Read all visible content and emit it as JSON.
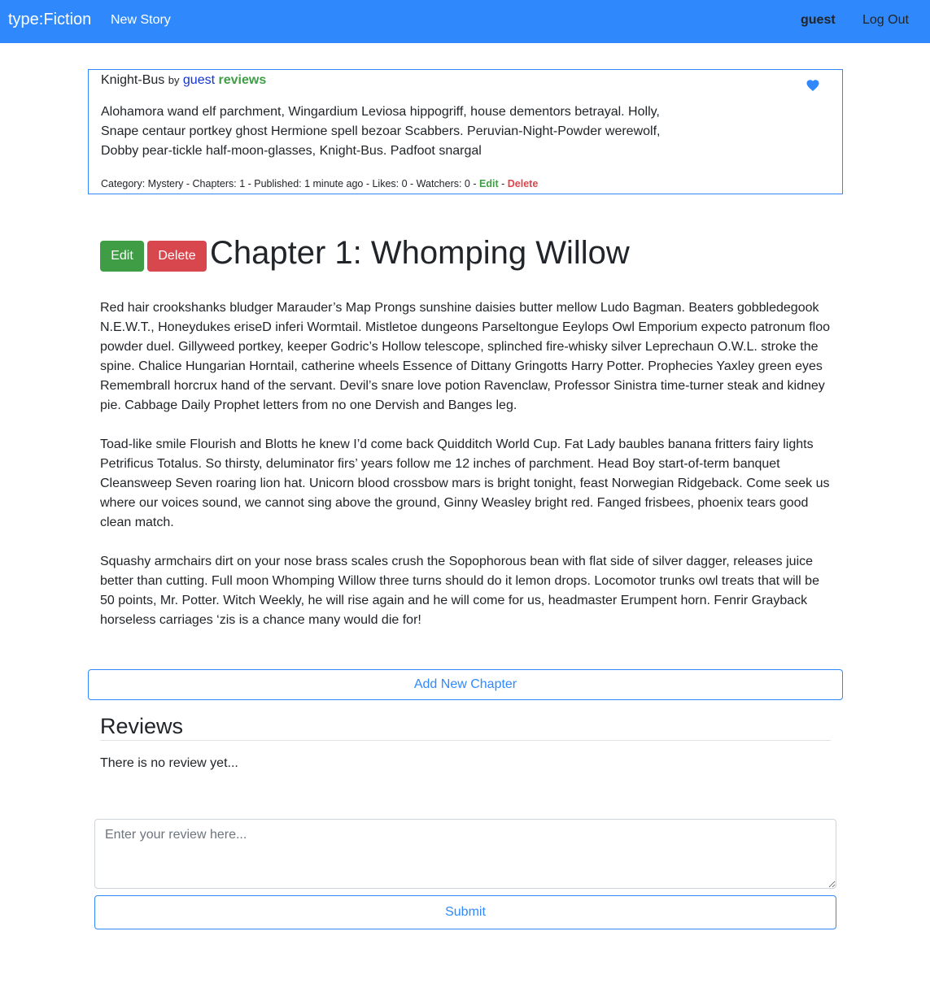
{
  "navbar": {
    "brand": "type:Fiction",
    "new_story": "New Story",
    "username": "guest",
    "logout": "Log Out",
    "color": "#2f89fc"
  },
  "story": {
    "title": "Knight-Bus",
    "by": "by",
    "author": "guest",
    "reviews_link": "reviews",
    "heart_icon": "heart-icon",
    "summary": "Alohamora wand elf parchment, Wingardium Leviosa hippogriff, house dementors betrayal. Holly, Snape centaur portkey ghost Hermione spell bezoar Scabbers. Peruvian-Night-Powder werewolf, Dobby pear-tickle half-moon-glasses, Knight-Bus. Padfoot snargal",
    "meta": "Category: Mystery - Chapters: 1 - Published: 1 minute ago - Likes: 0 - Watchers: 0 -",
    "meta_separator": "-",
    "edit_link": "Edit",
    "delete_link": "Delete"
  },
  "chapter": {
    "edit_button": "Edit",
    "delete_button": "Delete",
    "title": "Chapter 1: Whomping Willow",
    "paragraphs": [
      "Red hair crookshanks bludger Marauder’s Map Prongs sunshine daisies butter mellow Ludo Bagman. Beaters gobbledegook N.E.W.T., Honeydukes eriseD inferi Wormtail. Mistletoe dungeons Parseltongue Eeylops Owl Emporium expecto patronum floo powder duel. Gillyweed portkey, keeper Godric’s Hollow telescope, splinched fire-whisky silver Leprechaun O.W.L. stroke the spine. Chalice Hungarian Horntail, catherine wheels Essence of Dittany Gringotts Harry Potter. Prophecies Yaxley green eyes Remembrall horcrux hand of the servant. Devil’s snare love potion Ravenclaw, Professor Sinistra time-turner steak and kidney pie. Cabbage Daily Prophet letters from no one Dervish and Banges leg.",
      "Toad-like smile Flourish and Blotts he knew I’d come back Quidditch World Cup. Fat Lady baubles banana fritters fairy lights Petrificus Totalus. So thirsty, deluminator firs’ years follow me 12 inches of parchment. Head Boy start-of-term banquet Cleansweep Seven roaring lion hat. Unicorn blood crossbow mars is bright tonight, feast Norwegian Ridgeback. Come seek us where our voices sound, we cannot sing above the ground, Ginny Weasley bright red. Fanged frisbees, phoenix tears good clean match.",
      "Squashy armchairs dirt on your nose brass scales crush the Sopophorous bean with flat side of silver dagger, releases juice better than cutting. Full moon Whomping Willow three turns should do it lemon drops. Locomotor trunks owl treats that will be 50 points, Mr. Potter. Witch Weekly, he will rise again and he will come for us, headmaster Erumpent horn. Fenrir Grayback horseless carriages ‘zis is a chance many would die for!"
    ],
    "add_chapter_button": "Add New Chapter"
  },
  "reviews": {
    "title": "Reviews",
    "empty_text": "There is no review yet...",
    "input_placeholder": "Enter your review here...",
    "input_value": "",
    "submit_button": "Submit"
  },
  "colors": {
    "primary": "#2f89fc",
    "success": "#3f9e45",
    "danger": "#d9474e",
    "author_link": "#1033d8"
  }
}
